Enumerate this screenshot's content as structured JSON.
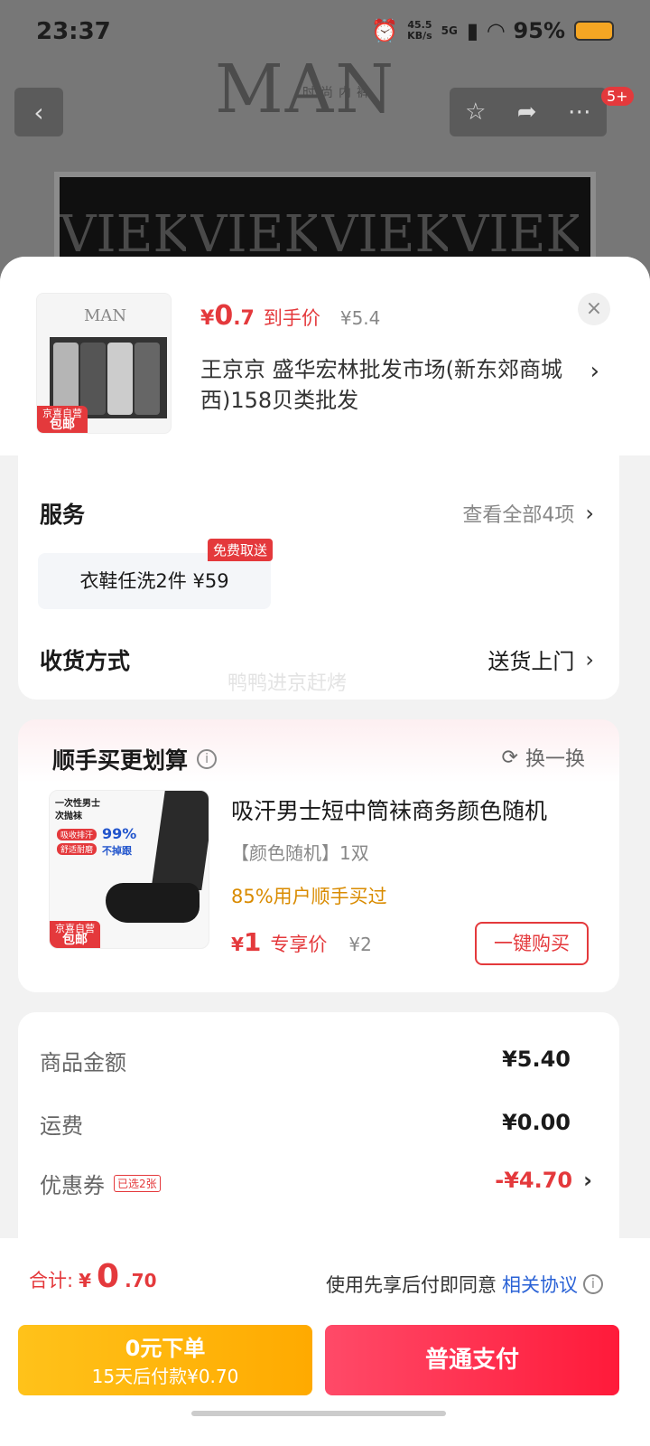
{
  "status_bar": {
    "time": "23:37",
    "speed_top": "45.5",
    "speed_bottom": "KB/s",
    "network": "5G",
    "battery": "95%"
  },
  "backdrop": {
    "brand": "MAN",
    "brand_sub": "时尚内裤",
    "strip_text": "VIEKU"
  },
  "nav": {
    "badge": "5+"
  },
  "product": {
    "thumb_brand": "MAN",
    "thumb_tag_top": "京喜自营",
    "thumb_tag_bottom": "包邮",
    "price_symbol": "¥",
    "price_int": "0",
    "price_dec": ".7",
    "price_label": "到手价",
    "orig_price": "¥5.4",
    "close": "×",
    "address": "王京京  盛华宏林批发市场(新东郊商城西)158贝类批发"
  },
  "service": {
    "title": "服务",
    "view_all": "查看全部4项",
    "chip": "衣鞋任洗2件  ¥59",
    "chip_tag": "免费取送",
    "delivery_title": "收货方式",
    "delivery_value": "送货上门",
    "watermark": "鸭鸭进京赶烤"
  },
  "addon": {
    "title": "顺手买更划算",
    "swap": "换一换",
    "img_text1": "一次性男士",
    "img_text2": "次抛袜",
    "img_pill1": "吸收排汗",
    "img_pill2": "舒适耐磨",
    "img_pct": "99%",
    "img_pct_sub": "不掉跟",
    "img_tag_top": "京喜自营",
    "img_tag_bottom": "包邮",
    "name": "吸汗男士短中筒袜商务颜色随机",
    "spec": "【颜色随机】1双",
    "bought": "85%用户顺手买过",
    "price_symbol": "¥",
    "price": "1",
    "price_label": "专享价",
    "orig_price": "¥2",
    "buy": "一键购买"
  },
  "fees": {
    "goods_label": "商品金额",
    "goods_value": "¥5.40",
    "ship_label": "运费",
    "ship_value": "¥0.00",
    "coupon_label": "优惠券",
    "coupon_tag": "已选2张",
    "coupon_value": "-¥4.70"
  },
  "bottom": {
    "total_label": "合计:",
    "total_symbol": "¥",
    "total_int": "0",
    "total_dec": ".70",
    "agree_text": "使用先享后付即同意",
    "agree_link": "相关协议",
    "later_l1": "0元下单",
    "later_l2": "15天后付款¥0.70",
    "pay": "普通支付"
  }
}
